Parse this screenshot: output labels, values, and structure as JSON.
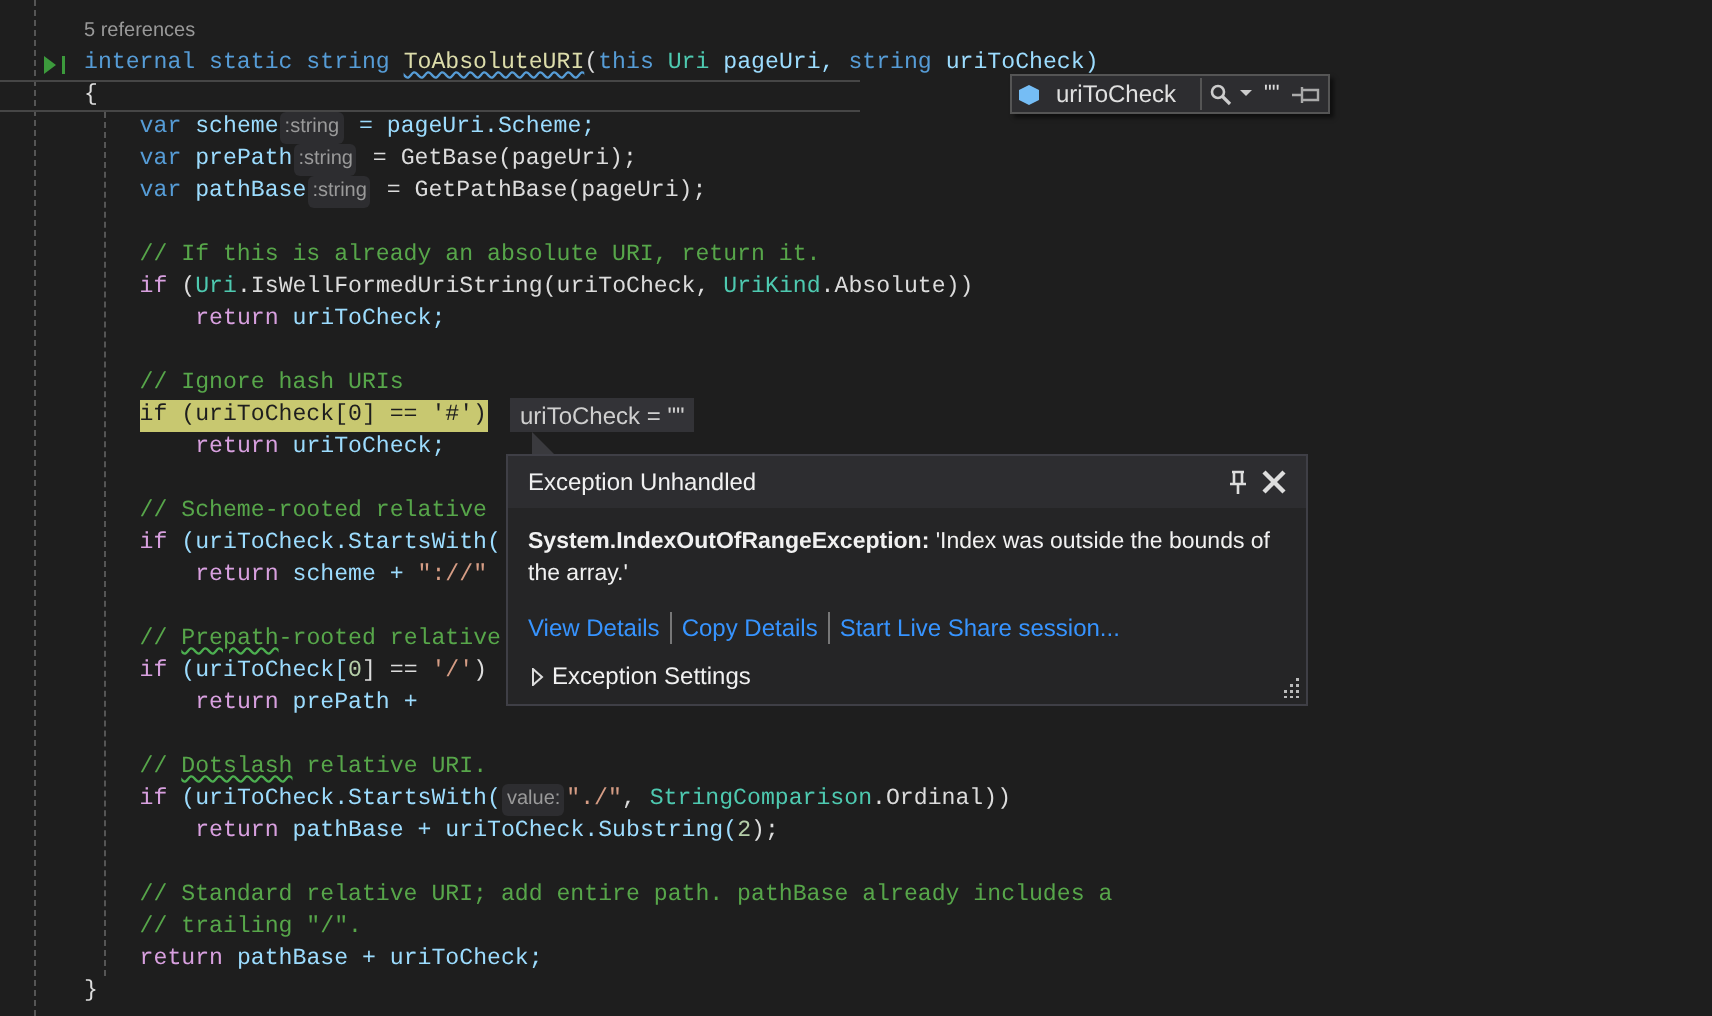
{
  "editor": {
    "references": "5 references",
    "signature": [
      {
        "text": "internal static string ",
        "kind": "keyword"
      },
      {
        "text": "ToAbsoluteURI",
        "kind": "flagged"
      },
      {
        "text": "(",
        "kind": "plain"
      },
      {
        "text": "this ",
        "kind": "keyword"
      },
      {
        "text": "Uri",
        "kind": "type"
      },
      {
        "text": " pageUri, ",
        "kind": "local"
      },
      {
        "text": "string",
        "kind": "keyword"
      },
      {
        "text": " uriToCheck)",
        "kind": "local"
      }
    ],
    "open_brace": {
      "text": "{",
      "current_line": true
    },
    "body": [
      {
        "kind": "code",
        "highlighted": false,
        "tokens": [
          {
            "text": "var",
            "kind": "keyword"
          },
          {
            "text": " scheme",
            "kind": "local"
          },
          {
            "text": ":string",
            "kind": "hint"
          },
          {
            "text": " = pageUri.Scheme;",
            "kind": "local"
          }
        ]
      },
      {
        "kind": "code",
        "highlighted": false,
        "tokens": [
          {
            "text": "var",
            "kind": "keyword"
          },
          {
            "text": " prePath",
            "kind": "local"
          },
          {
            "text": ":string",
            "kind": "hint"
          },
          {
            "text": " = GetBase(pageUri);",
            "kind": "plain"
          }
        ]
      },
      {
        "kind": "code",
        "highlighted": false,
        "tokens": [
          {
            "text": "var",
            "kind": "keyword"
          },
          {
            "text": " pathBase",
            "kind": "local"
          },
          {
            "text": ":string",
            "kind": "hint"
          },
          {
            "text": " = GetPathBase(pageUri);",
            "kind": "plain"
          }
        ]
      },
      {
        "kind": "blank"
      },
      {
        "kind": "code",
        "highlighted": false,
        "tokens": [
          {
            "text": "// If this is already an absolute URI, return it.",
            "kind": "comment"
          }
        ]
      },
      {
        "kind": "code",
        "highlighted": false,
        "tokens": [
          {
            "text": "if",
            "kind": "control"
          },
          {
            "text": " (",
            "kind": "plain"
          },
          {
            "text": "Uri",
            "kind": "type"
          },
          {
            "text": ".IsWellFormedUriString(uriToCheck, ",
            "kind": "plain"
          },
          {
            "text": "UriKind",
            "kind": "type"
          },
          {
            "text": ".Absolute))",
            "kind": "plain"
          }
        ],
        "children": [
          {
            "kind": "code",
            "highlighted": false,
            "tokens": [
              {
                "text": "return",
                "kind": "control"
              },
              {
                "text": " uriToCheck;",
                "kind": "local"
              }
            ]
          }
        ]
      },
      {
        "kind": "blank"
      },
      {
        "kind": "code",
        "highlighted": false,
        "tokens": [
          {
            "text": "// Ignore hash URIs",
            "kind": "comment"
          }
        ]
      },
      {
        "kind": "code",
        "highlighted": true,
        "tokens": [
          {
            "text": "if (uriToCheck[0] == '#')"
          }
        ],
        "children": [
          {
            "kind": "code",
            "highlighted": false,
            "tokens": [
              {
                "text": "return",
                "kind": "control"
              },
              {
                "text": " uriToCheck;",
                "kind": "local"
              }
            ]
          }
        ]
      },
      {
        "kind": "blank"
      },
      {
        "kind": "code",
        "highlighted": false,
        "tokens": [
          {
            "text": "// Scheme-rooted relative",
            "kind": "comment"
          }
        ]
      },
      {
        "kind": "code",
        "highlighted": false,
        "tokens": [
          {
            "text": "if",
            "kind": "control"
          },
          {
            "text": " (uriToCheck.StartsWith(",
            "kind": "local"
          }
        ],
        "children": [
          {
            "kind": "code",
            "highlighted": false,
            "tokens": [
              {
                "text": "return",
                "kind": "control"
              },
              {
                "text": " scheme + ",
                "kind": "local"
              },
              {
                "text": "\"://\"",
                "kind": "string"
              }
            ]
          }
        ]
      },
      {
        "kind": "blank"
      },
      {
        "kind": "code",
        "highlighted": false,
        "tokens": [
          {
            "text": "// ",
            "kind": "comment"
          },
          {
            "text": "Prepath",
            "kind": "misspelled"
          },
          {
            "text": "-rooted relative",
            "kind": "comment"
          }
        ]
      },
      {
        "kind": "code",
        "highlighted": false,
        "tokens": [
          {
            "text": "if",
            "kind": "control"
          },
          {
            "text": " (uriToCheck[",
            "kind": "local"
          },
          {
            "text": "0",
            "kind": "number"
          },
          {
            "text": "] == ",
            "kind": "plain"
          },
          {
            "text": "'/'",
            "kind": "string"
          },
          {
            "text": ")",
            "kind": "plain"
          }
        ],
        "children": [
          {
            "kind": "code",
            "highlighted": false,
            "tokens": [
              {
                "text": "return",
                "kind": "control"
              },
              {
                "text": " prePath +",
                "kind": "local"
              }
            ]
          }
        ]
      },
      {
        "kind": "blank"
      },
      {
        "kind": "code",
        "highlighted": false,
        "tokens": [
          {
            "text": "// ",
            "kind": "comment"
          },
          {
            "text": "Dotslash",
            "kind": "misspelled"
          },
          {
            "text": " relative URI.",
            "kind": "comment"
          }
        ]
      },
      {
        "kind": "code",
        "highlighted": false,
        "tokens": [
          {
            "text": "if",
            "kind": "control"
          },
          {
            "text": " (uriToCheck.StartsWith(",
            "kind": "local"
          },
          {
            "text": "value:",
            "kind": "hint"
          },
          {
            "text": "\"./\"",
            "kind": "string"
          },
          {
            "text": ", ",
            "kind": "plain"
          },
          {
            "text": "StringComparison",
            "kind": "type"
          },
          {
            "text": ".Ordinal))",
            "kind": "plain"
          }
        ],
        "children": [
          {
            "kind": "code",
            "highlighted": false,
            "tokens": [
              {
                "text": "return",
                "kind": "control"
              },
              {
                "text": " pathBase + uriToCheck.Substring(",
                "kind": "local"
              },
              {
                "text": "2",
                "kind": "number"
              },
              {
                "text": ");",
                "kind": "plain"
              }
            ]
          }
        ]
      },
      {
        "kind": "blank"
      },
      {
        "kind": "code",
        "highlighted": false,
        "tokens": [
          {
            "text": "// Standard relative URI; add entire path. pathBase already includes a",
            "kind": "comment"
          }
        ]
      },
      {
        "kind": "code",
        "highlighted": false,
        "tokens": [
          {
            "text": "// trailing \"/\".",
            "kind": "comment"
          }
        ]
      },
      {
        "kind": "code",
        "highlighted": false,
        "tokens": [
          {
            "text": "return",
            "kind": "control"
          },
          {
            "text": " pathBase + uriToCheck;",
            "kind": "local"
          }
        ]
      }
    ],
    "close_brace": "}"
  },
  "pinned_datatip": {
    "name": "uriToCheck",
    "value": "\"\""
  },
  "hover_datatip": {
    "text": "uriToCheck = \"\""
  },
  "exception_popup": {
    "title": "Exception Unhandled",
    "message": "**System.IndexOutOfRangeException:** 'Index was outside the bounds of the array.'",
    "links": [
      "View Details",
      "Copy Details",
      "Start Live Share session..."
    ],
    "settings": {
      "label": "Exception Settings",
      "expanded": false
    }
  }
}
